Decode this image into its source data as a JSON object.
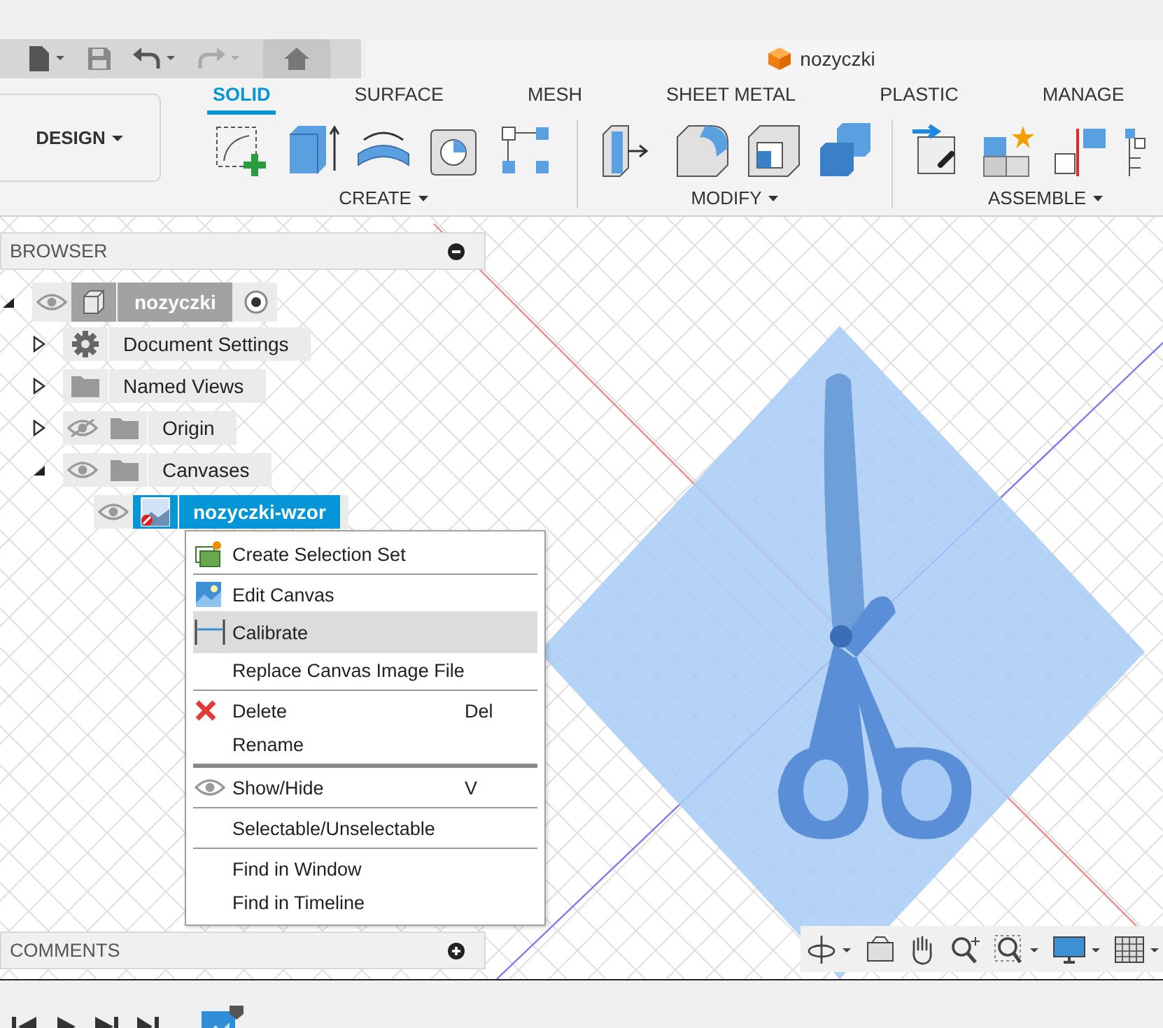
{
  "document_tab": {
    "title": "nozyczki"
  },
  "workspace_button": {
    "label": "DESIGN"
  },
  "ribbon_tabs": [
    {
      "label": "SOLID",
      "selected": true
    },
    {
      "label": "SURFACE",
      "selected": false
    },
    {
      "label": "MESH",
      "selected": false
    },
    {
      "label": "SHEET METAL",
      "selected": false
    },
    {
      "label": "PLASTIC",
      "selected": false
    },
    {
      "label": "MANAGE",
      "selected": false
    }
  ],
  "ribbon_groups": [
    {
      "kind": "create",
      "label": "CREATE"
    },
    {
      "kind": "modify",
      "label": "MODIFY"
    },
    {
      "kind": "assemble",
      "label": "ASSEMBLE"
    }
  ],
  "browser": {
    "title": "BROWSER",
    "root": {
      "label": "nozyczki",
      "kind": "component",
      "visible": true,
      "expanded": true,
      "children": [
        {
          "label": "Document Settings",
          "kind": "settings",
          "expanded": false
        },
        {
          "label": "Named Views",
          "kind": "folder",
          "expanded": false
        },
        {
          "label": "Origin",
          "kind": "folder",
          "visible": false,
          "expanded": false
        },
        {
          "label": "Canvases",
          "kind": "folder",
          "visible": true,
          "expanded": true,
          "children": [
            {
              "label": "nozyczki-wzor",
              "kind": "canvas",
              "visible": true,
              "selected": true
            }
          ]
        }
      ]
    }
  },
  "context_menu": {
    "sections": [
      [
        {
          "label": "Create Selection Set",
          "kind": "selection-set",
          "selected": false
        }
      ],
      [
        {
          "label": "Edit Canvas",
          "kind": "canvas",
          "selected": false
        },
        {
          "label": "Calibrate",
          "kind": "calibrate",
          "selected": true
        },
        {
          "label": "Replace Canvas Image File",
          "kind": "none",
          "selected": false
        }
      ],
      [
        {
          "label": "Delete",
          "kind": "delete",
          "shortcut": "Del",
          "selected": false
        },
        {
          "label": "Rename",
          "kind": "none",
          "selected": false
        }
      ],
      [
        {
          "label": "Show/Hide",
          "kind": "eye",
          "shortcut": "V",
          "selected": false
        }
      ],
      [
        {
          "label": "Selectable/Unselectable",
          "kind": "none",
          "selected": false
        }
      ],
      [
        {
          "label": "Find in Window",
          "kind": "none",
          "selected": false
        },
        {
          "label": "Find in Timeline",
          "kind": "none",
          "selected": false
        }
      ]
    ]
  },
  "comments": {
    "title": "COMMENTS"
  }
}
